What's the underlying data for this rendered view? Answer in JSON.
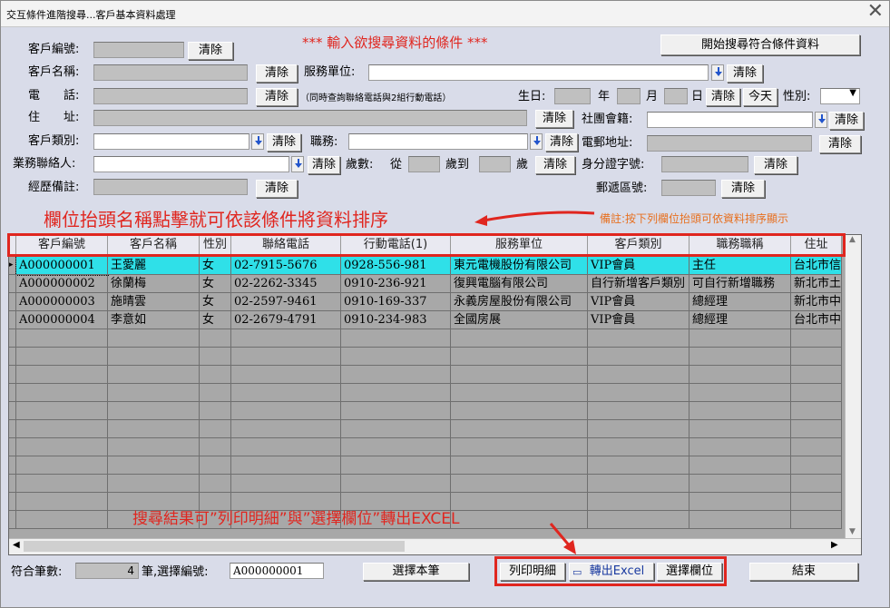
{
  "window": {
    "title": "交互條件進階搜尋...客戶基本資料處理",
    "close": "✕"
  },
  "form": {
    "heading": "***  輸入欲搜尋資料的條件  ***",
    "search_button": "開始搜尋符合條件資料",
    "clear": "清除",
    "labels": {
      "customer_no": "客戶編號:",
      "customer_name": "客戶名稱:",
      "service_unit": "服務單位:",
      "phone": "電　　話:",
      "phone_hint": "（同時查詢聯絡電話與2組行動電話）",
      "birthday": "生日:",
      "year": "年",
      "month": "月",
      "day": "日",
      "today": "今天",
      "gender": "性別:",
      "address": "住　　址:",
      "club": "社團會籍:",
      "customer_type": "客戶類別:",
      "job": "職務:",
      "email": "電郵地址:",
      "sales_contact": "業務聯絡人:",
      "age": "歲數:",
      "age_from": "從",
      "age_to": "歲到",
      "age_unit": "歲",
      "id_no": "身分證字號:",
      "history": "經歷備註:",
      "postal": "郵遞區號:"
    }
  },
  "annotations": {
    "sort_hint": "欄位抬頭名稱點擊就可依該條件將資料排序",
    "sort_note": "備註:按下列欄位抬頭可依資料排序顯示",
    "export_hint": "搜尋結果可”列印明細”與”選擇欄位”轉出EXCEL"
  },
  "grid": {
    "columns": [
      "客戶編號",
      "客戶名稱",
      "性別",
      "聯絡電話",
      "行動電話(1)",
      "服務單位",
      "客戶類別",
      "職務職稱",
      "住址"
    ],
    "rows": [
      [
        "A000000001",
        "王愛麗",
        "女",
        "02-7915-5676",
        "0928-556-981",
        "東元電機股份有限公司",
        "VIP會員",
        "主任",
        "台北市信"
      ],
      [
        "A000000002",
        "徐蘭梅",
        "女",
        "02-2262-3345",
        "0910-236-921",
        "復興電腦有限公司",
        "自行新增客戶類別",
        "可自行新增職務",
        "新北市土"
      ],
      [
        "A000000003",
        "施晴雲",
        "女",
        "02-2597-9461",
        "0910-169-337",
        "永義房屋股份有限公司",
        "VIP會員",
        "總經理",
        "新北市中"
      ],
      [
        "A000000004",
        "李意如",
        "女",
        "02-2679-4791",
        "0910-234-983",
        "全國房展",
        "VIP會員",
        "總經理",
        "台北市中"
      ]
    ],
    "selected_row": 0,
    "row_marker": "▸"
  },
  "footer": {
    "match_count_label": "符合筆數:",
    "match_count": "4",
    "selected_label": "筆,選擇編號:",
    "selected_id": "A000000001",
    "select_button": "選擇本筆",
    "print_button": "列印明細",
    "excel_button": "轉出Excel",
    "column_button": "選擇欄位",
    "end_button": "結束"
  },
  "colors": {
    "selected_row": "#2fe0e8",
    "annotation_red": "#e0261f",
    "annotation_orange": "#e77020",
    "window_bg": "#d9dce9"
  }
}
